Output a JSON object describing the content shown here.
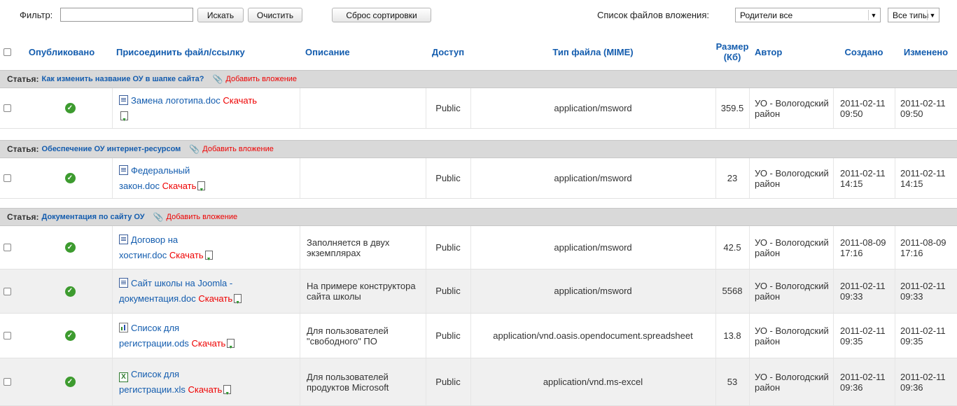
{
  "toolbar": {
    "filter_label": "Фильтр:",
    "filter_value": "",
    "search_button": "Искать",
    "clear_button": "Очистить",
    "reset_sort_button": "Сброс сортировки",
    "list_label": "Список файлов вложения:",
    "parents_select": "Родители все",
    "types_select": "Все типы"
  },
  "columns": {
    "published": "Опубликовано",
    "attach": "Присоединить файл/ссылку",
    "description": "Описание",
    "access": "Доступ",
    "mime": "Тип файла (MIME)",
    "size": "Размер (Кб)",
    "author": "Автор",
    "created": "Создано",
    "modified": "Изменено"
  },
  "group_prefix": "Статья:",
  "add_attachment": "Добавить вложение",
  "download_label": "Скачать",
  "groups": [
    {
      "title": "Как изменить название ОУ в шапке сайта?",
      "rows": [
        {
          "file_l1": "Замена логотипа.doc",
          "file_l2": "",
          "icon": "word-doc-icon",
          "description": "",
          "access": "Public",
          "mime": "application/msword",
          "size": "359.5",
          "author": "УО - Вологодский район",
          "created": "2011-02-11 09:50",
          "modified": "2011-02-11 09:50"
        }
      ]
    },
    {
      "title": "Обеспечение ОУ интернет-ресурсом",
      "rows": [
        {
          "file_l1": "Федеральный",
          "file_l2": "закон.doc",
          "icon": "word-doc-icon",
          "description": "",
          "access": "Public",
          "mime": "application/msword",
          "size": "23",
          "author": "УО - Вологодский район",
          "created": "2011-02-11 14:15",
          "modified": "2011-02-11 14:15"
        }
      ]
    },
    {
      "title": "Документация по сайту ОУ",
      "rows": [
        {
          "file_l1": "Договор на",
          "file_l2": "хостинг.doc",
          "icon": "word-doc-icon",
          "description": "Заполняется в двух экземплярах",
          "access": "Public",
          "mime": "application/msword",
          "size": "42.5",
          "author": "УО - Вологодский район",
          "created": "2011-08-09 17:16",
          "modified": "2011-08-09 17:16"
        },
        {
          "file_l1": "Сайт школы на Joomla -",
          "file_l2": "документация.doc",
          "icon": "word-doc-icon",
          "description": "На примере конструктора сайта школы",
          "access": "Public",
          "mime": "application/msword",
          "size": "5568",
          "author": "УО - Вологодский район",
          "created": "2011-02-11 09:33",
          "modified": "2011-02-11 09:33"
        },
        {
          "file_l1": "Список для",
          "file_l2": "регистрации.ods",
          "icon": "spreadsheet-ods-icon",
          "description": "Для пользователей \"свободного\" ПО",
          "access": "Public",
          "mime": "application/vnd.oasis.opendocument.spreadsheet",
          "size": "13.8",
          "author": "УО - Вологодский район",
          "created": "2011-02-11 09:35",
          "modified": "2011-02-11 09:35"
        },
        {
          "file_l1": "Список для",
          "file_l2": "регистрации.xls",
          "icon": "excel-xls-icon",
          "description": "Для пользователей продуктов Microsoft",
          "access": "Public",
          "mime": "application/vnd.ms-excel",
          "size": "53",
          "author": "УО - Вологодский район",
          "created": "2011-02-11 09:36",
          "modified": "2011-02-11 09:36"
        }
      ]
    }
  ]
}
